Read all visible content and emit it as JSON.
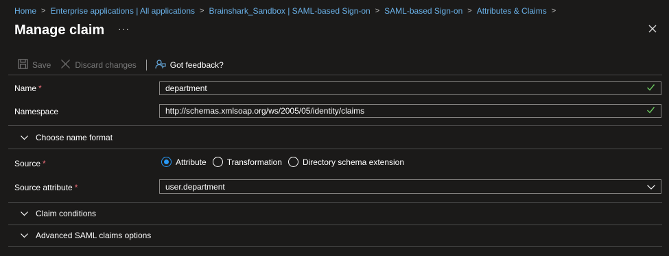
{
  "breadcrumb": {
    "items": [
      {
        "label": "Home"
      },
      {
        "label": "Enterprise applications | All applications"
      },
      {
        "label": "Brainshark_Sandbox | SAML-based Sign-on"
      },
      {
        "label": "SAML-based Sign-on"
      },
      {
        "label": "Attributes & Claims"
      }
    ],
    "separator": ">"
  },
  "header": {
    "title": "Manage claim",
    "more": "···"
  },
  "toolbar": {
    "save_label": "Save",
    "discard_label": "Discard changes",
    "feedback_label": "Got feedback?"
  },
  "form": {
    "name": {
      "label": "Name",
      "required": "*",
      "value": "department"
    },
    "namespace": {
      "label": "Namespace",
      "value": "http://schemas.xmlsoap.org/ws/2005/05/identity/claims"
    },
    "name_format": {
      "label": "Choose name format"
    },
    "source": {
      "label": "Source",
      "required": "*",
      "options": [
        "Attribute",
        "Transformation",
        "Directory schema extension"
      ],
      "selected": "Attribute"
    },
    "source_attribute": {
      "label": "Source attribute",
      "required": "*",
      "value": "user.department"
    },
    "claim_conditions": {
      "label": "Claim conditions"
    },
    "advanced": {
      "label": "Advanced SAML claims options"
    }
  },
  "colors": {
    "background": "#1b1a19",
    "link": "#69afe5",
    "accent": "#2899f5",
    "valid": "#6ccb5f",
    "required": "#f1707b"
  }
}
